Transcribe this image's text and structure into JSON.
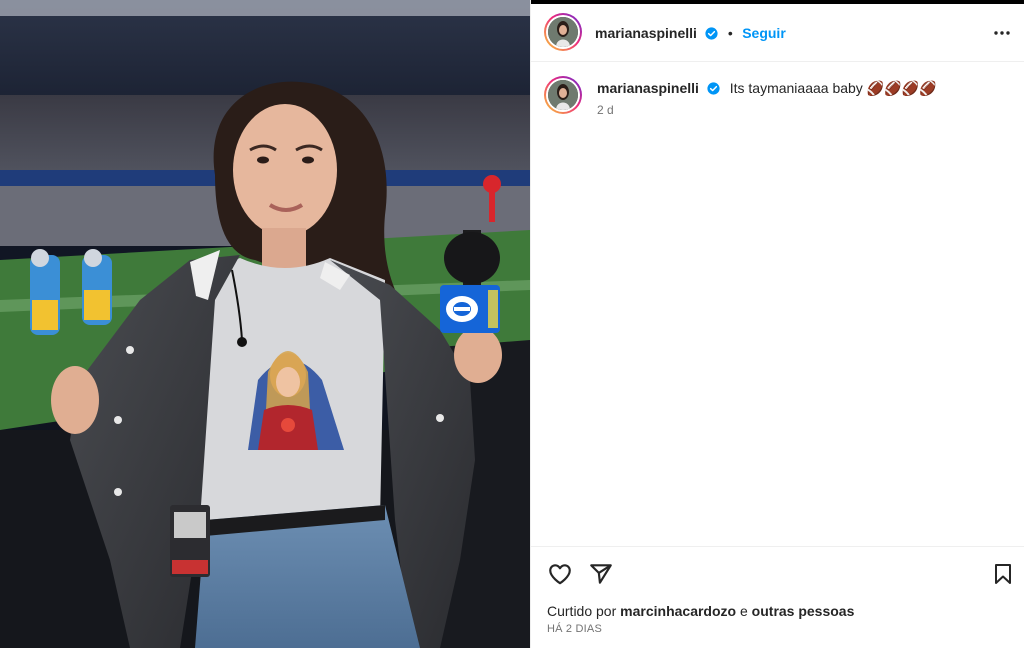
{
  "post": {
    "username": "marianaspinelli",
    "follow_label": "Seguir",
    "separator": "•",
    "verified_icon": "verified-badge-icon",
    "caption_username": "marianaspinelli",
    "caption_text": "Its taymaniaaaa baby 🏈🏈🏈🏈",
    "caption_time": "2 d",
    "more_icon": "more-options-icon"
  },
  "actions": {
    "icons": [
      "heart-icon",
      "share-icon",
      "bookmark-icon"
    ],
    "liked_by_prefix": "Curtido por",
    "liked_by_user": "marcinhacardozo",
    "liked_by_joiner": "e",
    "liked_by_others": "outras pessoas",
    "posted_ago": "HÁ 2 DIAS"
  },
  "colors": {
    "accent": "#0095f6",
    "verified": "#0095f6",
    "text": "#262626",
    "muted": "#737373",
    "divider": "#efefef"
  }
}
